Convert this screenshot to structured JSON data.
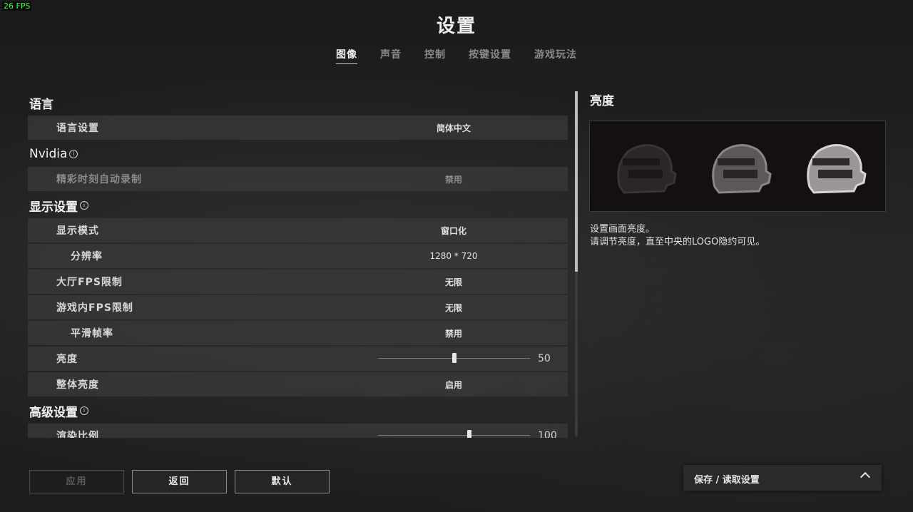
{
  "fps_counter": "26 FPS",
  "title": "设置",
  "tabs": [
    {
      "label": "图像",
      "active": true
    },
    {
      "label": "声音",
      "active": false
    },
    {
      "label": "控制",
      "active": false
    },
    {
      "label": "按键设置",
      "active": false
    },
    {
      "label": "游戏玩法",
      "active": false
    }
  ],
  "sections": {
    "language": {
      "title": "语言",
      "rows": {
        "language_setting": {
          "label": "语言设置",
          "value": "简体中文"
        }
      }
    },
    "nvidia": {
      "title": "Nvidia",
      "rows": {
        "highlights": {
          "label": "精彩时刻自动录制",
          "value": "禁用"
        }
      }
    },
    "display": {
      "title": "显示设置",
      "rows": {
        "display_mode": {
          "label": "显示模式",
          "value": "窗口化"
        },
        "resolution": {
          "label": "分辨率",
          "value": "1280 * 720"
        },
        "lobby_fps": {
          "label": "大厅FPS限制",
          "value": "无限"
        },
        "ingame_fps": {
          "label": "游戏内FPS限制",
          "value": "无限"
        },
        "smooth_framerate": {
          "label": "平滑帧率",
          "value": "禁用"
        },
        "brightness": {
          "label": "亮度",
          "value": "50",
          "level": 0.5
        },
        "overall_brightness": {
          "label": "整体亮度",
          "value": "启用"
        }
      }
    },
    "advanced": {
      "title": "高级设置",
      "rows": {
        "render_scale": {
          "label": "渲染比例",
          "value": "100",
          "level": 0.6
        }
      }
    }
  },
  "right_panel": {
    "title": "亮度",
    "desc_line1": "设置画面亮度。",
    "desc_line2": "请调节亮度，直至中央的LOGO隐约可见。"
  },
  "buttons": {
    "apply": "应用",
    "back": "返回",
    "default": "默认",
    "save_load": "保存 / 读取设置"
  },
  "icons": {
    "info": "info-icon",
    "chevron": "chevron-up-icon",
    "helmet": "helmet-logo-icon"
  },
  "colors": {
    "accent": "#f0f0f0",
    "row_bg": "#3a3a3a",
    "disabled_text": "#8c8c8c"
  }
}
